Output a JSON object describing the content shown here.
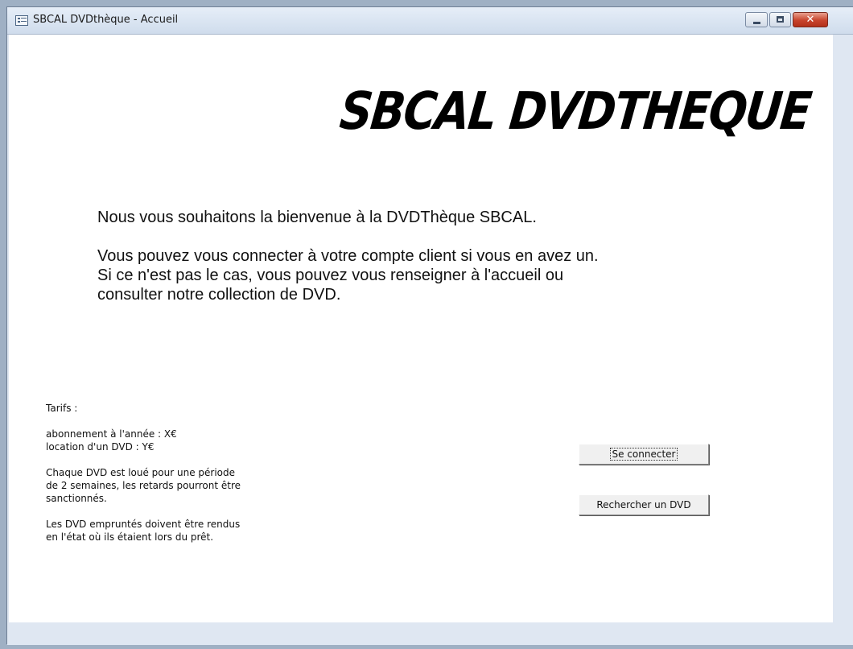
{
  "window": {
    "title": "SBCAL DVDthèque - Accueil",
    "controls": {
      "minimize": "",
      "maximize": "",
      "close": "✕"
    }
  },
  "logo": "SBCAL DVDTHEQUE",
  "welcome": {
    "line1": "Nous vous souhaitons la bienvenue à la DVDThèque SBCAL.",
    "line2": "Vous pouvez vous connecter à votre compte client si vous en avez un.",
    "line3": "Si ce n'est pas le cas, vous pouvez vous renseigner à l'accueil ou",
    "line4": "consulter notre collection de DVD."
  },
  "info": {
    "tarifs_heading": "Tarifs :",
    "abonnement": "abonnement à l'année : X€",
    "location": "location d'un DVD : Y€",
    "period_1": "Chaque DVD est loué pour une période",
    "period_2": "de 2 semaines, les retards pourront être",
    "period_3": "sanctionnés.",
    "return_1": "Les DVD empruntés doivent être rendus",
    "return_2": "en l'état où ils étaient lors du prêt."
  },
  "buttons": {
    "login": "Se connecter",
    "search": "Rechercher un DVD"
  },
  "colors": {
    "titlebar": "#dfe7f2",
    "close_button": "#c7442c",
    "background": "#ffffff"
  }
}
